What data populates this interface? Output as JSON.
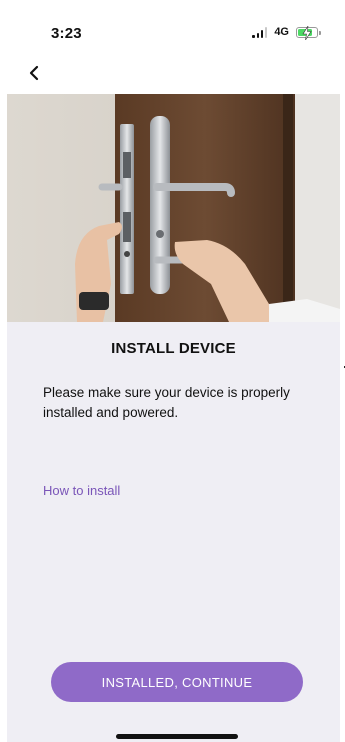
{
  "status_bar": {
    "time": "3:23",
    "network": "4G"
  },
  "page": {
    "title": "INSTALL DEVICE",
    "description": "Please make sure your device is properly installed and powered.",
    "how_to_link": "How to install",
    "continue_button": "INSTALLED, CONTINUE"
  },
  "colors": {
    "accent": "#8f6ac8",
    "link": "#7a55b8",
    "background": "#efeef4",
    "battery_charging": "#4cd964"
  },
  "icons": {
    "back": "back-chevron-icon",
    "signal": "cellular-signal-icon",
    "battery": "battery-charging-icon"
  }
}
